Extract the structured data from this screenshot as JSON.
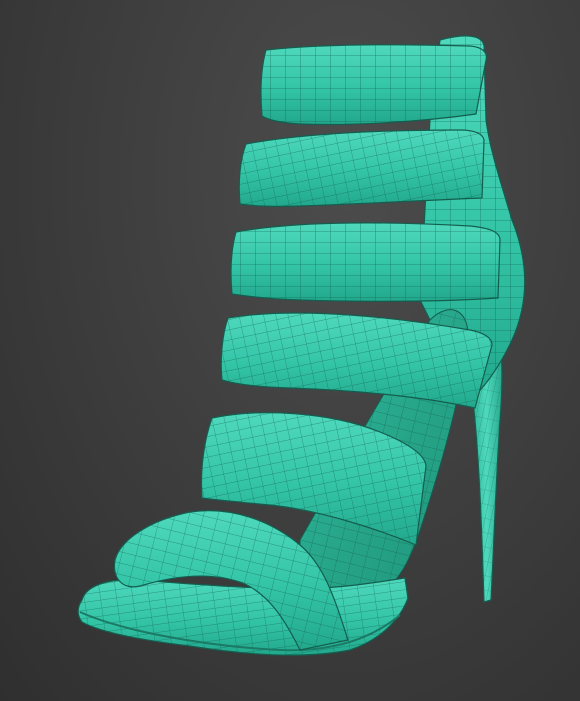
{
  "viewport": {
    "title": "",
    "colors": {
      "background_center": "#4c4c4c",
      "background_edge": "#2f2f2f",
      "mesh_fill": "#33c4a6",
      "mesh_highlight": "#5fe0c6",
      "mesh_shadow": "#1f8f78",
      "wire": "#0f5e4e"
    },
    "model": {
      "object": "strappy-high-heel-sandal",
      "display_mode": "shaded-with-wireframe",
      "strap_count": 5,
      "parts": [
        "ankle-strap",
        "strap-2",
        "strap-3",
        "strap-4",
        "strap-5",
        "toe-strap",
        "heel-counter",
        "stiletto-heel",
        "sole-platform"
      ]
    }
  }
}
